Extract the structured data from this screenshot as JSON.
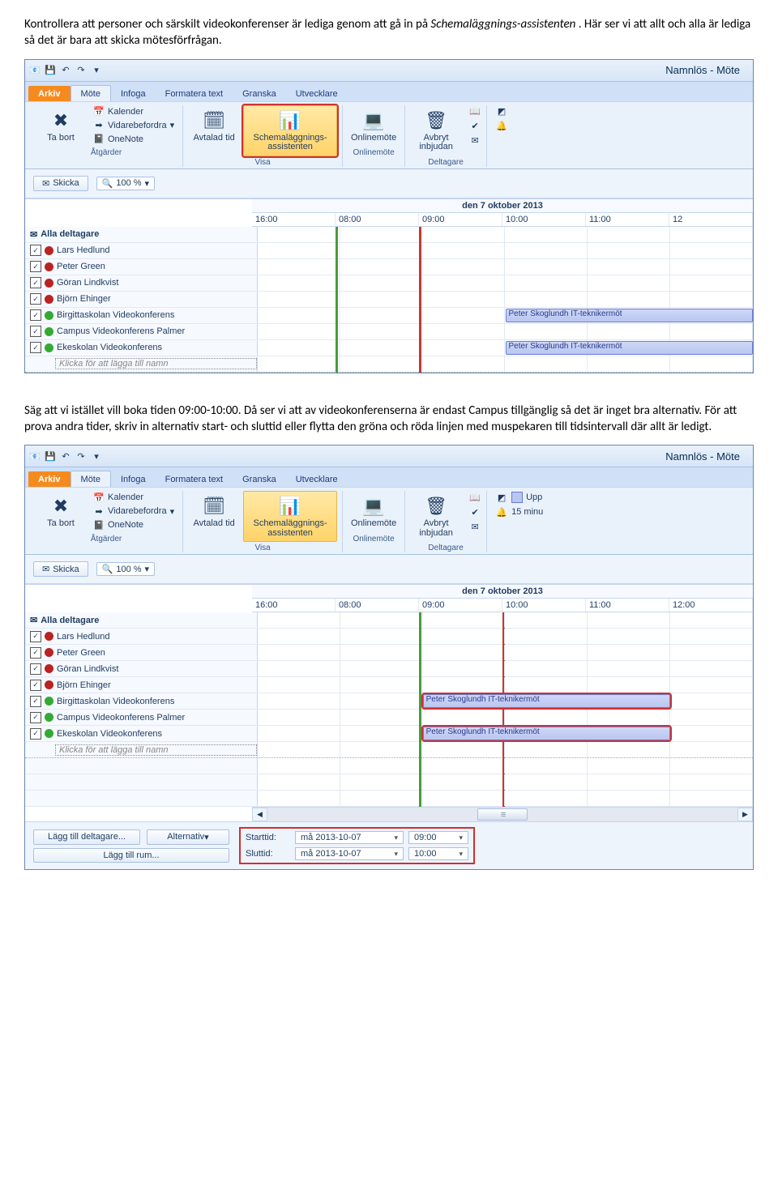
{
  "doc": {
    "p1a": "Kontrollera att personer och särskilt videokonferenser är lediga genom att gå in på ",
    "p1b": "Schemaläggnings-assistenten",
    "p1c": ". Här ser vi att allt och alla är lediga så det är bara att skicka mötesförfrågan.",
    "p2": "Säg att vi istället vill boka tiden 09:00-10:00. Då ser vi att av videokonferenserna är endast Campus tillgänglig så det är inget bra alternativ. För att prova andra tider, skriv in alternativ start- och sluttid eller flytta den gröna och röda linjen med muspekaren till tidsintervall där allt är ledigt."
  },
  "app": {
    "title": "Namnlös  -  Möte",
    "tabs": {
      "file": "Arkiv",
      "t1": "Möte",
      "t2": "Infoga",
      "t3": "Formatera text",
      "t4": "Granska",
      "t5": "Utvecklare"
    },
    "ribbon": {
      "atgarder": {
        "name": "Åtgärder",
        "delete": "Ta bort",
        "calendar": "Kalender",
        "forward": "Vidarebefordra",
        "onenote": "OneNote"
      },
      "visa": {
        "name": "Visa",
        "appt": "Avtalad tid",
        "sched": "Schemaläggnings-assistenten"
      },
      "online": {
        "name": "Onlinemöte",
        "btn": "Onlinemöte"
      },
      "deltagare": {
        "name": "Deltagare",
        "cancel": "Avbryt inbjudan",
        "upp": "Upp",
        "mins": "15 minu"
      }
    },
    "subbar": {
      "send": "Skicka",
      "zoom": "100 %"
    }
  },
  "grid": {
    "date": "den 7 oktober 2013",
    "times1": [
      "16:00",
      "08:00",
      "09:00",
      "10:00",
      "11:00",
      "12"
    ],
    "times2": [
      "16:00",
      "08:00",
      "09:00",
      "10:00",
      "11:00",
      "12:00"
    ],
    "allhead": "Alla deltagare",
    "attendees": [
      {
        "name": "Lars Hedlund",
        "color": "red"
      },
      {
        "name": "Peter Green",
        "color": "red"
      },
      {
        "name": "Göran Lindkvist",
        "color": "red"
      },
      {
        "name": "Björn Ehinger",
        "color": "red"
      },
      {
        "name": "Birgittaskolan Videokonferens",
        "color": "grn"
      },
      {
        "name": "Campus Videokonferens Palmer",
        "color": "grn"
      },
      {
        "name": "Ekeskolan Videokonferens",
        "color": "grn"
      }
    ],
    "addname": "Klicka för att lägga till namn",
    "busy_label": "Peter Skoglundh IT-teknikermöt"
  },
  "bottom": {
    "addatt": "Lägg till deltagare...",
    "alt": "Alternativ",
    "addroom": "Lägg till rum...",
    "start_lab": "Starttid:",
    "end_lab": "Sluttid:",
    "date_val": "må 2013-10-07",
    "start_time": "09:00",
    "end_time": "10:00"
  }
}
